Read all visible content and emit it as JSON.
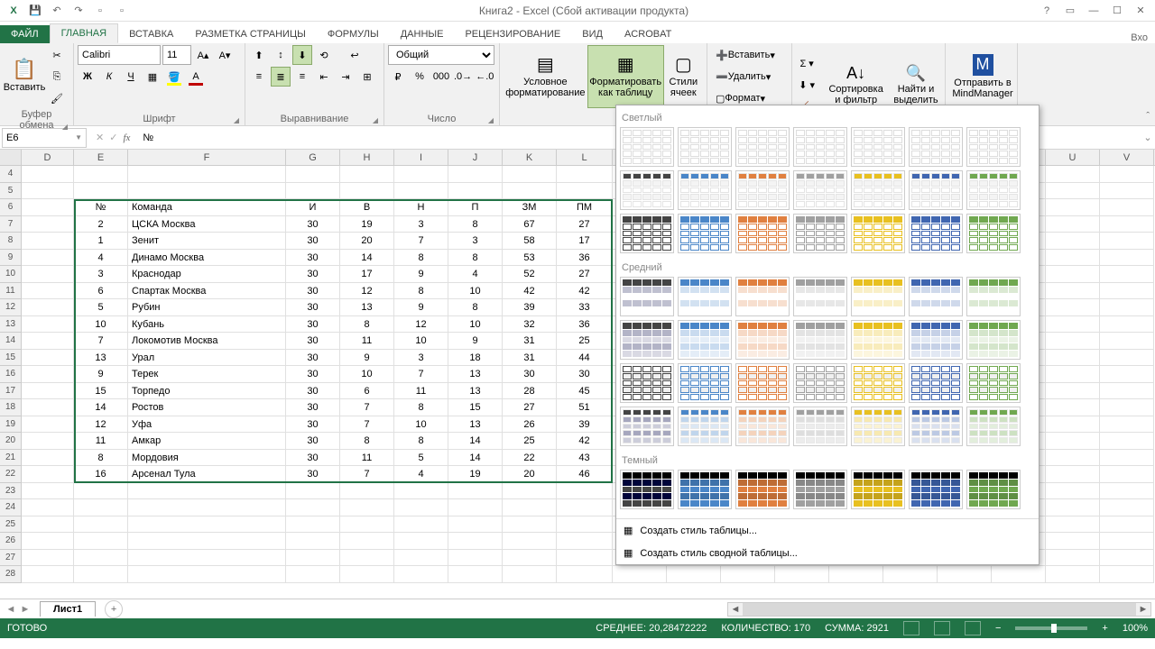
{
  "title": "Книга2 - Excel (Сбой активации продукта)",
  "user_right": "Вхо",
  "tabs": [
    "ФАЙЛ",
    "ГЛАВНАЯ",
    "ВСТАВКА",
    "РАЗМЕТКА СТРАНИЦЫ",
    "ФОРМУЛЫ",
    "ДАННЫЕ",
    "РЕЦЕНЗИРОВАНИЕ",
    "ВИД",
    "ACROBAT"
  ],
  "active_tab": 1,
  "ribbon": {
    "clipboard": {
      "paste": "Вставить",
      "label": "Буфер обмена"
    },
    "font": {
      "name": "Calibri",
      "size": "11",
      "label": "Шрифт"
    },
    "align": {
      "label": "Выравнивание"
    },
    "number": {
      "format": "Общий",
      "label": "Число"
    },
    "styles": {
      "cond": "Условное форматирование",
      "table": "Форматировать как таблицу",
      "cell": "Стили ячеек"
    },
    "cells": {
      "insert": "Вставить",
      "delete": "Удалить",
      "format": "Формат"
    },
    "editing": {
      "sort": "Сортировка и фильтр",
      "find": "Найти и выделить"
    },
    "mindmgr": "Отправить в MindManager"
  },
  "namebox": "E6",
  "formula": "№",
  "columns": [
    "D",
    "E",
    "F",
    "G",
    "H",
    "I",
    "J",
    "K",
    "L",
    "",
    "",
    "",
    "",
    "",
    "",
    "",
    "",
    "U",
    "V"
  ],
  "first_row_num": 4,
  "headers": [
    "№",
    "Команда",
    "И",
    "В",
    "Н",
    "П",
    "ЗМ",
    "ПМ"
  ],
  "rows": [
    [
      2,
      "ЦСКА Москва",
      30,
      19,
      3,
      8,
      67,
      27
    ],
    [
      1,
      "Зенит",
      30,
      20,
      7,
      3,
      58,
      17
    ],
    [
      4,
      "Динамо Москва",
      30,
      14,
      8,
      8,
      53,
      36
    ],
    [
      3,
      "Краснодар",
      30,
      17,
      9,
      4,
      52,
      27
    ],
    [
      6,
      "Спартак Москва",
      30,
      12,
      8,
      10,
      42,
      42
    ],
    [
      5,
      "Рубин",
      30,
      13,
      9,
      8,
      39,
      33
    ],
    [
      10,
      "Кубань",
      30,
      8,
      12,
      10,
      32,
      36
    ],
    [
      7,
      "Локомотив Москва",
      30,
      11,
      10,
      9,
      31,
      25
    ],
    [
      13,
      "Урал",
      30,
      9,
      3,
      18,
      31,
      44
    ],
    [
      9,
      "Терек",
      30,
      10,
      7,
      13,
      30,
      30
    ],
    [
      15,
      "Торпедо",
      30,
      6,
      11,
      13,
      28,
      45
    ],
    [
      14,
      "Ростов",
      30,
      7,
      8,
      15,
      27,
      51
    ],
    [
      12,
      "Уфа",
      30,
      7,
      10,
      13,
      26,
      39
    ],
    [
      11,
      "Амкар",
      30,
      8,
      8,
      14,
      25,
      42
    ],
    [
      8,
      "Мордовия",
      30,
      11,
      5,
      14,
      22,
      43
    ],
    [
      16,
      "Арсенал Тула",
      30,
      7,
      4,
      19,
      20,
      46
    ]
  ],
  "styles_popup": {
    "light": "Светлый",
    "medium": "Средний",
    "dark": "Темный",
    "new_table": "Создать стиль таблицы...",
    "new_pivot": "Создать стиль сводной таблицы..."
  },
  "sheet": {
    "name": "Лист1"
  },
  "status": {
    "ready": "ГОТОВО",
    "avg_label": "СРЕДНЕЕ:",
    "avg": "20,28472222",
    "count_label": "КОЛИЧЕСТВО:",
    "count": "170",
    "sum_label": "СУММА:",
    "sum": "2921",
    "zoom": "100%"
  },
  "palette": [
    "#444",
    "#4a86c8",
    "#e08040",
    "#a0a0a0",
    "#e8c020",
    "#4066b0",
    "#70a850"
  ]
}
